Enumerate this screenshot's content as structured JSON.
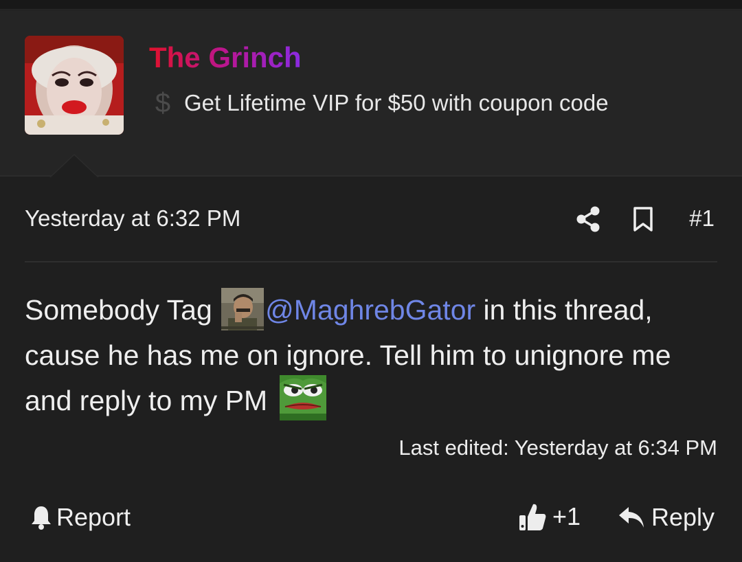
{
  "header": {
    "username": "The Grinch",
    "banner_icon": "dollar-icon",
    "banner_text": "Get Lifetime VIP for $50 with coupon code",
    "username_gradient": [
      "#e0122c",
      "#b5179a",
      "#8a2be2"
    ]
  },
  "post": {
    "timestamp": "Yesterday at 6:32 PM",
    "post_number": "#1",
    "message": {
      "part1": "Somebody Tag ",
      "mention": "@MaghrebGator",
      "part2": " in this thread, cause he has me on ignore. Tell him to unignore me and reply to my PM "
    },
    "last_edited": "Last edited: Yesterday at 6:34 PM"
  },
  "actions": {
    "report_label": "Report",
    "like_count": "+1",
    "reply_label": "Reply"
  },
  "colors": {
    "background": "#1f1f1f",
    "header_background": "#252525",
    "mention": "#6f86e6",
    "text": "#ececec"
  }
}
